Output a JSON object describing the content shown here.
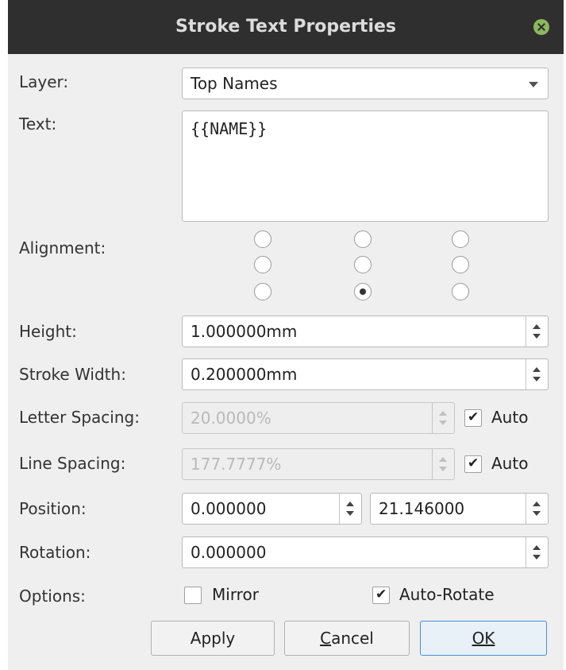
{
  "window": {
    "title": "Stroke Text Properties"
  },
  "layer": {
    "label": "Layer:",
    "value": "Top Names"
  },
  "text": {
    "label": "Text:",
    "value": "{{NAME}}"
  },
  "alignment": {
    "label": "Alignment:",
    "selected": "bottom-center"
  },
  "height": {
    "label": "Height:",
    "value": "1.000000mm"
  },
  "stroke_width": {
    "label": "Stroke Width:",
    "value": "0.200000mm"
  },
  "letter_spacing": {
    "label": "Letter Spacing:",
    "value": "20.0000%",
    "auto_label": "Auto",
    "auto_checked": true
  },
  "line_spacing": {
    "label": "Line Spacing:",
    "value": "177.7777%",
    "auto_label": "Auto",
    "auto_checked": true
  },
  "position": {
    "label": "Position:",
    "x": "0.000000",
    "y": "21.146000"
  },
  "rotation": {
    "label": "Rotation:",
    "value": "0.000000"
  },
  "options": {
    "label": "Options:",
    "mirror_label": "Mirror",
    "mirror_checked": false,
    "auto_rotate_label": "Auto-Rotate",
    "auto_rotate_checked": true
  },
  "buttons": {
    "apply": "Apply",
    "cancel_mnemonic": "C",
    "cancel_rest": "ancel",
    "ok": "OK"
  }
}
